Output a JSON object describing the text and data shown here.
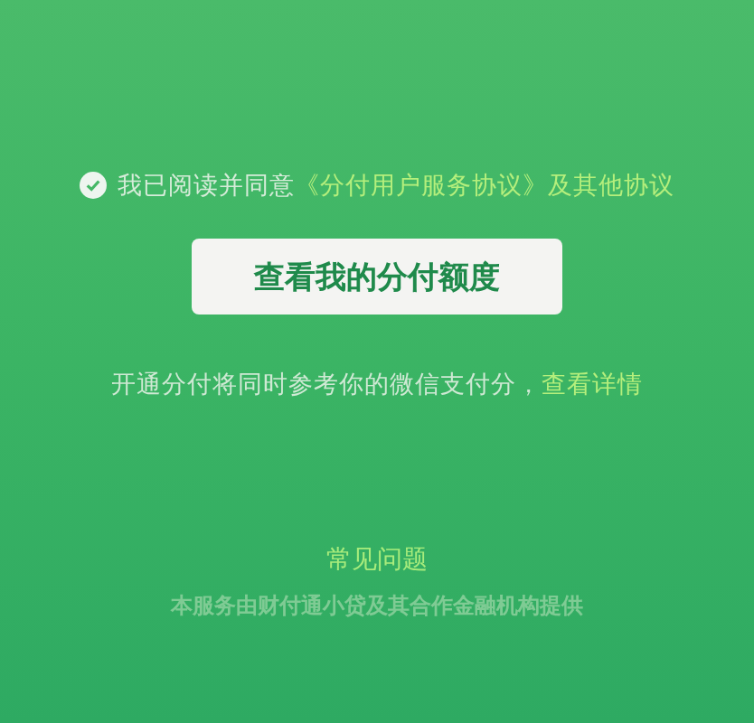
{
  "agreement": {
    "checked": true,
    "prefix": "我已阅读并同意",
    "links": [
      "《分付用户服务协议》",
      "及其他协议"
    ]
  },
  "primary_button": "查看我的分付额度",
  "notice": {
    "text": "开通分付将同时参考你的微信支付分，",
    "link": "查看详情"
  },
  "faq_link": "常见问题",
  "footer": "本服务由财付通小贷及其合作金融机构提供"
}
